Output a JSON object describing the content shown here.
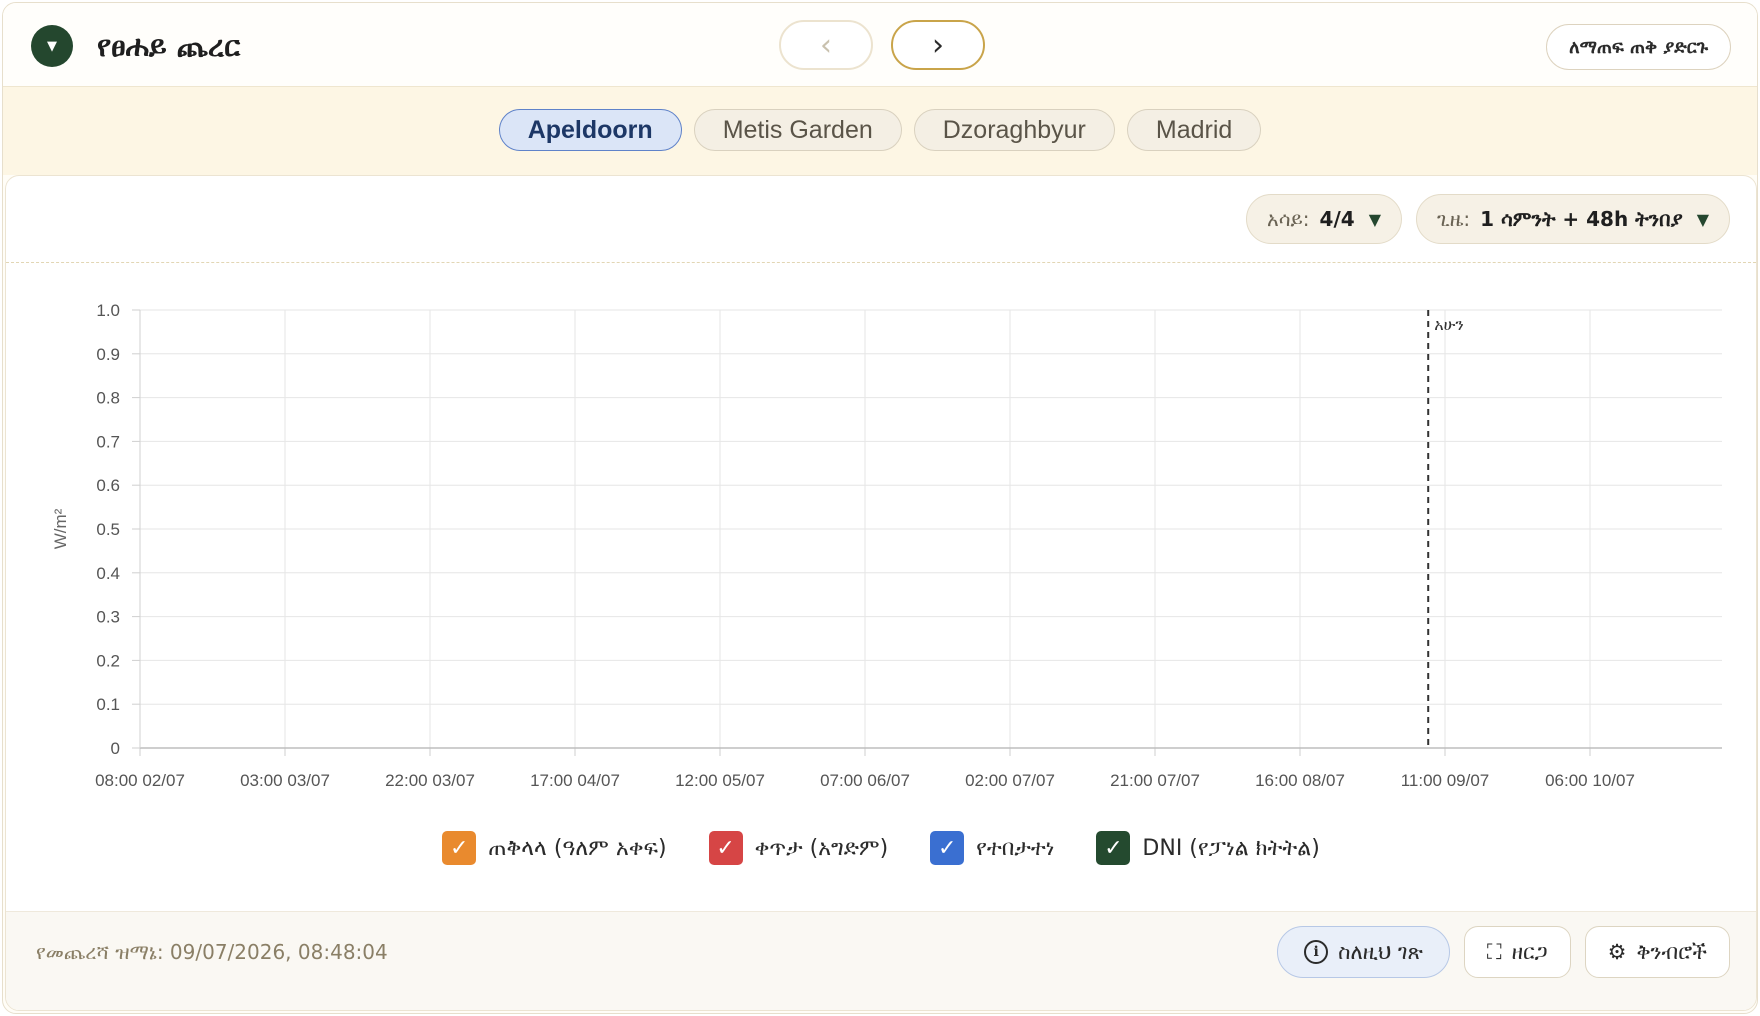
{
  "header": {
    "logo_glyph": "▼",
    "title": "የፀሐይ ጨረር",
    "prev_glyph": "‹",
    "next_glyph": "›",
    "subscribe_label": "ለማጠፍ ጠቅ ያድርጉ"
  },
  "locations": {
    "tabs": [
      {
        "label": "Apeldoorn",
        "active": true
      },
      {
        "label": "Metis Garden",
        "active": false
      },
      {
        "label": "Dzoraghbyur",
        "active": false
      },
      {
        "label": "Madrid",
        "active": false
      }
    ]
  },
  "filters": {
    "series_label": "አሳይ:",
    "series_value": "4/4",
    "time_label": "ጊዜ:",
    "time_value": "1 ሳምንት + 48h ትንበያ",
    "caret": "▼"
  },
  "chart_data": {
    "type": "line",
    "ylabel": "W/m²",
    "ylim": [
      0,
      1.0
    ],
    "y_ticks": [
      "1.0",
      "0.9",
      "0.8",
      "0.7",
      "0.6",
      "0.5",
      "0.4",
      "0.3",
      "0.2",
      "0.1",
      "0"
    ],
    "x_ticks": [
      "08:00 02/07",
      "03:00 03/07",
      "22:00 03/07",
      "17:00 04/07",
      "12:00 05/07",
      "07:00 06/07",
      "02:00 07/07",
      "21:00 07/07",
      "16:00 08/07",
      "11:00 09/07",
      "06:00 10/07"
    ],
    "now_marker": {
      "label": "አሁን",
      "x": "08:48 09/07"
    },
    "grid": true,
    "series": [
      {
        "name": "ጠቅላላ (ዓለም አቀፍ)",
        "color": "#e98a2e",
        "values": []
      },
      {
        "name": "ቀጥታ (አግድም)",
        "color": "#d64545",
        "values": []
      },
      {
        "name": "የተበታተነ",
        "color": "#3a6fd1",
        "values": []
      },
      {
        "name": "DNI (የፓነል ክትትል)",
        "color": "#244a2f",
        "values": []
      }
    ]
  },
  "legend": {
    "check_glyph": "✓",
    "items": [
      {
        "label": "ጠቅላላ (ዓለም አቀፍ)",
        "color": "#e98a2e"
      },
      {
        "label": "ቀጥታ (አግድም)",
        "color": "#d64545"
      },
      {
        "label": "የተበታተነ",
        "color": "#3a6fd1"
      },
      {
        "label": "DNI (የፓነል ክትትል)",
        "color": "#244a2f"
      }
    ]
  },
  "footer": {
    "updated_text": "የመጨረሻ ዝማኔ: 09/07/2026, 08:48:04",
    "about_icon": "i",
    "about_label": "ስለዚህ ገጽ",
    "zoom_icon": "⛶",
    "zoom_label": "ዘርጋ",
    "settings_icon": "⚙",
    "settings_label": "ቅንብሮች"
  }
}
